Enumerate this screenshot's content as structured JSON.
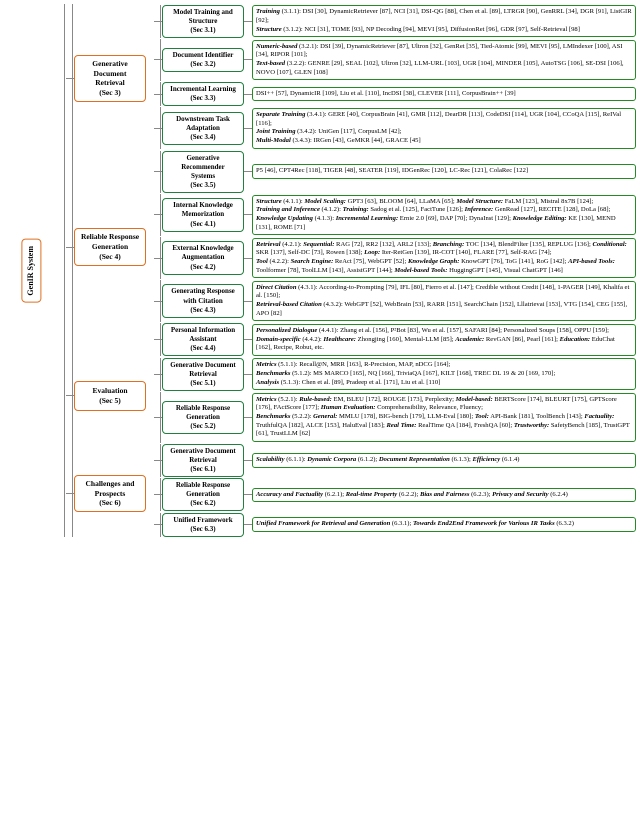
{
  "root_label": "GenIR System",
  "sections": [
    {
      "id": "sec3",
      "label": "Generative Document\nRetrieval\n(Sec 3)",
      "color": "orange",
      "subsections": [
        {
          "id": "sec31",
          "label": "Model Training and\nStructure\n(Sec 3.1)",
          "color": "green",
          "content": "<em>Training</em> (3.1.1): DSI [30], DynamicRetriever [87], NCI [31], DSI-QG [88], Chen et al. [89], LTRGR [90], GenRRL [34], DGR [91], ListGIR [92];<br><em>Structure</em> (3.1.2): NCI [31], TOME [93], NP Decoding [94], MEVI [95], DiffusionRet [96], GDR [97], Self-Retrieval [98]"
        },
        {
          "id": "sec32",
          "label": "Document Identifier\n(Sec 3.2)",
          "color": "green",
          "content": "<em>Numeric-based</em> (3.2.1): DSI [39], DynamicRetriever [87], Ultron [32], GenRet [35], Tied-Atomic [99], MEVI [95], LMIndexer [100], ASI [34], RIPOR [101];<br><em>Text-based</em> (3.2.2): GENRE [29], SEAL [102], Ultron [32], LLM-URL [103], UGR [104], MINDER [105], AutoTSG [106], SE-DSI [106], NOVO [107], GLEN [108]"
        },
        {
          "id": "sec33",
          "label": "Incremental Learning\n(Sec 3.3)",
          "color": "green",
          "content": "DSI++ [57], DynamicIR [109], Liu et al. [110], IncDSI [38], CLEVER [111], CorpusBrain++ [39]"
        },
        {
          "id": "sec34",
          "label": "Downstream Task\nAdaptation\n(Sec 3.4)",
          "color": "green",
          "content": "<em>Separate Training</em> (3.4.1): GERE [40], CorpusBrain [41], GMR [112], DearDR [113], CodeDSI [114], UGR [104], CCoQA [115], ReIVal [116];<br><em>Joint Training</em> (3.4.2): UniGen [117], CorpusLM [42];<br><em>Multi-Modal</em> (3.4.3): IRGen [43], GeMKR [44], GRACE [45]"
        },
        {
          "id": "sec35",
          "label": "Generative Recommender\nSystems\n(Sec 3.5)",
          "color": "green",
          "content": "P5 [46], CPT4Rec [118], TIGER [48], SEATER [119], IDGenRec [120], LC-Rec [121], ColaRec [122]"
        }
      ]
    },
    {
      "id": "sec4",
      "label": "Reliable Response\nGeneration\n(Sec 4)",
      "color": "orange",
      "subsections": [
        {
          "id": "sec41",
          "label": "Internal Knowledge\nMemorization\n(Sec 4.1)",
          "color": "green",
          "content": "<em>Structure</em> (4.1.1): <em>Model Scaling</em>: GPT3 [63], BLOOM [64], LLaMA [65]; <em>Model Structure</em>: FaLM [123], Mistral 8x7B [124];<br><em>Training and Inference</em> (4.1.2): <em>Training:</em> Sadog et al. [125], FactTune [126]; <em>Inference:</em> GenRead [127], RECITE [128], DoLa [68];<br><em>Knowledge Updating</em> (4.1.3): <em>Incremental Learning:</em> Ernie 2.0 [69], DAP [70]; DynaInst [129]; <em>Knowledge Editing:</em> KE [130], MEND [131], ROME [71]"
        },
        {
          "id": "sec42",
          "label": "External Knowledge\nAugmentation\n(Sec 4.2)",
          "color": "green",
          "content": "<em>Retrieval</em> (4.2.1): <em>Sequential:</em> RAG [72], RR2 [132], ARL2 [133]; <em>Branching:</em> TOC [134], BlendFilter [135], REPLUG [136]; <em>Conditional:</em> SKR [137], Self-DC [73], Rowen [138]; <em>Loop:</em> Iter-RetGen [139], IR-COT [140], FLARE [77], Self-RAG [74];<br><em>Tool</em> (4.2.2): <em>Search Engine:</em> ReAct [75], WebGPT [52]; <em>Knowledge Graph:</em> KnowGPT [76], ToG [141], RoG [142]; <em>API-based Tools:</em> Toolformer [78], ToolLLM [143], AssistGPT [144]; <em>Model-based Tools:</em> HuggingGPT [145], Visual ChatGPT [146]"
        },
        {
          "id": "sec43",
          "label": "Generating Response\nwith Citation\n(Sec 4.3)",
          "color": "green",
          "content": "<em>Direct Citation</em> (4.3.1): According-to-Prompting [79], IFL [80], Fierro et al. [147]; Credible without Credit [148], 1-PAGER [149], Khalifa et al. [150];<br><em>Retrieval-based Citation</em> (4.3.2): WebGPT [52], WebBrain [53], RARR [151], SearchChain [152], Lllatrievai [153], VTG [154], CEG [155], APO [82]"
        },
        {
          "id": "sec44",
          "label": "Personal Information\nAssistant\n(Sec 4.4)",
          "color": "green",
          "content": "<em>Personalized Dialogue</em> (4.4.1): Zhang et al. [156], P²Bot [83], Wu et al. [157], SAFARI [84]; Personalized Soups [158], OPPU [159];<br><em>Domain-specific</em> (4.4.2): <em>Healthcare:</em> Zhongjing [160], Mental-LLM [85]; <em>Academic:</em> RevGAN [86], Pearl [161]; <em>Education:</em> EduChat [162], Recipe, Robut, etc."
        }
      ]
    },
    {
      "id": "sec5",
      "label": "Evaluation\n(Sec 5)",
      "color": "orange",
      "subsections": [
        {
          "id": "sec51",
          "label": "Generative Document\nRetrieval\n(Sec 5.1)",
          "color": "green",
          "content": "<em>Metrics</em> (5.1.1): Recall@N, MRR [163], R-Precision, MAP, nDCG [164];<br><em>Benchmarks</em> (5.1.2): MS MARCO [165], NQ [166], TriviaQA [167], KILT [168], TREC DL 19 & 20 [169, 170];<br><em>Analysis</em> (5.1.3): Chen et al. [89], Pradeep et al. [171], Liu et al. [110]"
        },
        {
          "id": "sec52",
          "label": "Reliable Response\nGeneration\n(Sec 5.2)",
          "color": "green",
          "content": "<em>Metrics</em> (5.2.1): <em>Rule-based:</em> EM, BLEU [172], ROUGE [173], Perplexity; <em>Model-based:</em> BERTScore [174], BLEURT [175], GPTScore [176], FActScore [177]; <em>Human Evaluation:</em> Comprehensibility, Relevance, Fluency;<br><em>Benchmarks</em> (5.2.2): <em>General:</em> MMLU [178], BIG-bench [179], LLM-Eval [180]; <em>Tool:</em> API-Bank [181], ToolBench [143]; <em>Factuality:</em> TruthfulQA [182], ALCE [153], HaluEval [183]; <em>Real Time:</em> RealTime QA [184], FreshQA [60]; <em>Trustworthy:</em> SafetyBench [185], TrustGPT [61], TrustLLM [62]"
        }
      ]
    },
    {
      "id": "sec6",
      "label": "Challenges and\nProspects\n(Sec 6)",
      "color": "orange",
      "subsections": [
        {
          "id": "sec61",
          "label": "Generative Document\nRetrieval\n(Sec 6.1)",
          "color": "green",
          "content": "<em>Scalability</em> (6.1.1): <em>Dynamic Corpora</em> (6.1.2); <em>Document Representation</em> (6.1.3); <em>Efficiency</em> (6.1.4)"
        },
        {
          "id": "sec62",
          "label": "Reliable Response\nGeneration\n(Sec 6.2)",
          "color": "green",
          "content": "<em>Accuracy and Factuality</em> (6.2.1); <em>Real-time Property</em> (6.2.2); <em>Bias and Fairness</em> (6.2.3); <em>Privacy and Security</em> (6.2.4)"
        },
        {
          "id": "sec63",
          "label": "Unified Framework\n(Sec 6.3)",
          "color": "green",
          "content": "<em>Unified Framework for Retrieval and Generation</em> (6.3.1); <em>Towards End2End Framework for Various IR Tasks</em> (6.3.2)"
        }
      ]
    }
  ]
}
